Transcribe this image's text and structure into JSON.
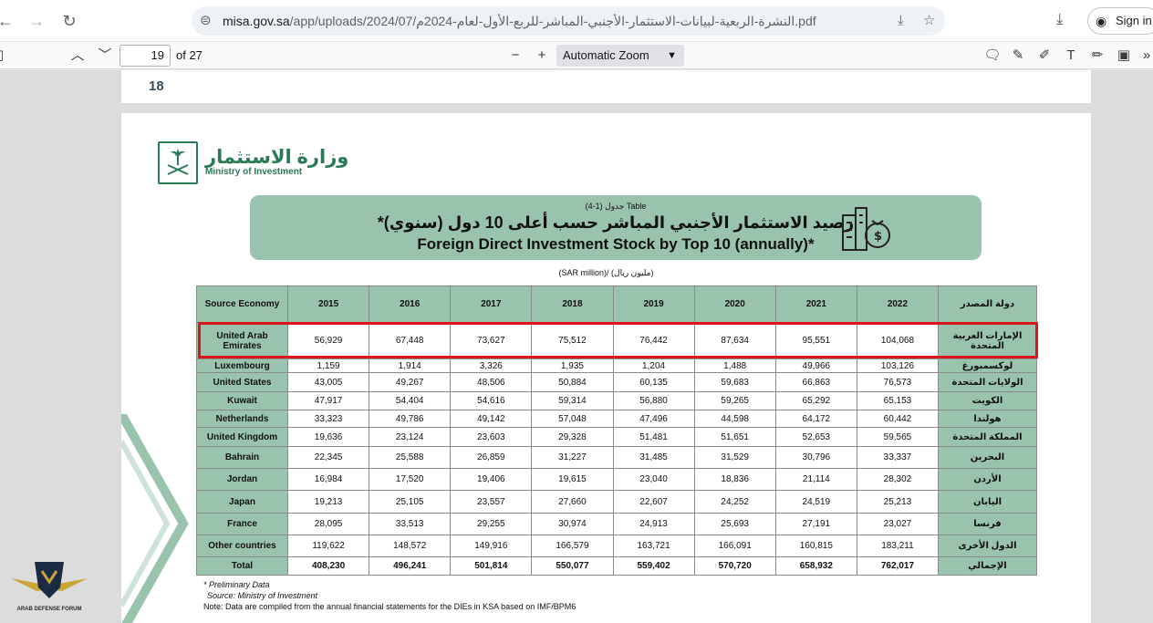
{
  "browser": {
    "url_domain": "misa.gov.sa",
    "url_path": "/app/uploads/2024/07/النشرة-الربعية-لبيانات-الاستثمار-الأجنبي-المباشر-للربع-الأول-لعام-2024م.pdf",
    "signin_label": "Sign in"
  },
  "pdf_toolbar": {
    "page_number": "19",
    "page_of": "of 27",
    "zoom_label": "Automatic Zoom"
  },
  "prev_page_number": "18",
  "logo": {
    "arabic": "وزارة الاستثمار",
    "english": "Ministry of Investment"
  },
  "banner": {
    "table_label": "جدول (1-4) Table",
    "title_ar": "رصيد الاستثمار الأجنبي المباشر حسب أعلى 10 دول (سنوي)*",
    "title_en": "Foreign Direct Investment Stock by Top 10  (annually)*"
  },
  "unit_label": "(SAR million)/ (مليون ريال)",
  "table": {
    "header_left": "Source Economy",
    "header_right": "دولة المصدر",
    "years": [
      "2015",
      "2016",
      "2017",
      "2018",
      "2019",
      "2020",
      "2021",
      "2022"
    ],
    "rows": [
      {
        "en": "United Arab Emirates",
        "ar": "الإمارات العربية المتحدة",
        "values": [
          "56,929",
          "67,448",
          "73,627",
          "75,512",
          "76,442",
          "87,634",
          "95,551",
          "104,068"
        ]
      },
      {
        "en": "Luxembourg",
        "ar": "لوكسمبورغ",
        "values": [
          "1,159",
          "1,914",
          "3,326",
          "1,935",
          "1,204",
          "1,488",
          "49,966",
          "103,126"
        ]
      },
      {
        "en": "United States",
        "ar": "الولايات المتحدة",
        "values": [
          "43,005",
          "49,267",
          "48,506",
          "50,884",
          "60,135",
          "59,683",
          "66,863",
          "76,573"
        ]
      },
      {
        "en": "Kuwait",
        "ar": "الكويت",
        "values": [
          "47,917",
          "54,404",
          "54,616",
          "59,314",
          "56,880",
          "59,265",
          "65,292",
          "65,153"
        ]
      },
      {
        "en": "Netherlands",
        "ar": "هولندا",
        "values": [
          "33,323",
          "49,786",
          "49,142",
          "57,048",
          "47,496",
          "44,598",
          "64,172",
          "60,442"
        ]
      },
      {
        "en": "United Kingdom",
        "ar": "المملكة المتحدة",
        "values": [
          "19,636",
          "23,124",
          "23,603",
          "29,328",
          "51,481",
          "51,651",
          "52,653",
          "59,565"
        ]
      },
      {
        "en": "Bahrain",
        "ar": "البحرين",
        "values": [
          "22,345",
          "25,588",
          "26,859",
          "31,227",
          "31,485",
          "31,529",
          "30,796",
          "33,337"
        ]
      },
      {
        "en": "Jordan",
        "ar": "الأردن",
        "values": [
          "16,984",
          "17,520",
          "19,406",
          "19,615",
          "23,040",
          "18,836",
          "21,114",
          "28,302"
        ]
      },
      {
        "en": "Japan",
        "ar": "اليابان",
        "values": [
          "19,213",
          "25,105",
          "23,557",
          "27,660",
          "22,607",
          "24,252",
          "24,519",
          "25,213"
        ]
      },
      {
        "en": "France",
        "ar": "فرنسا",
        "values": [
          "28,095",
          "33,513",
          "29,255",
          "30,974",
          "24,913",
          "25,693",
          "27,191",
          "23,027"
        ]
      },
      {
        "en": "Other countries",
        "ar": "الدول الأخرى",
        "values": [
          "119,622",
          "148,572",
          "149,916",
          "166,579",
          "163,721",
          "166,091",
          "160,815",
          "183,211"
        ]
      },
      {
        "en": "Total",
        "ar": "الإجمالي",
        "values": [
          "408,230",
          "496,241",
          "501,814",
          "550,077",
          "559,402",
          "570,720",
          "658,932",
          "762,017"
        ]
      }
    ]
  },
  "notes": {
    "preliminary": "* Preliminary Data",
    "source": "Source: Ministry of Investment",
    "note": "Note: Data are compiled from the annual financial statements for the DIEs in KSA based on IMF/BPM6"
  },
  "watermark": "ARAB DEFENSE FORUM",
  "colors": {
    "table_green": "#9ac3ad",
    "highlight_red": "#d8161b",
    "brand_green": "#2a7a55"
  }
}
